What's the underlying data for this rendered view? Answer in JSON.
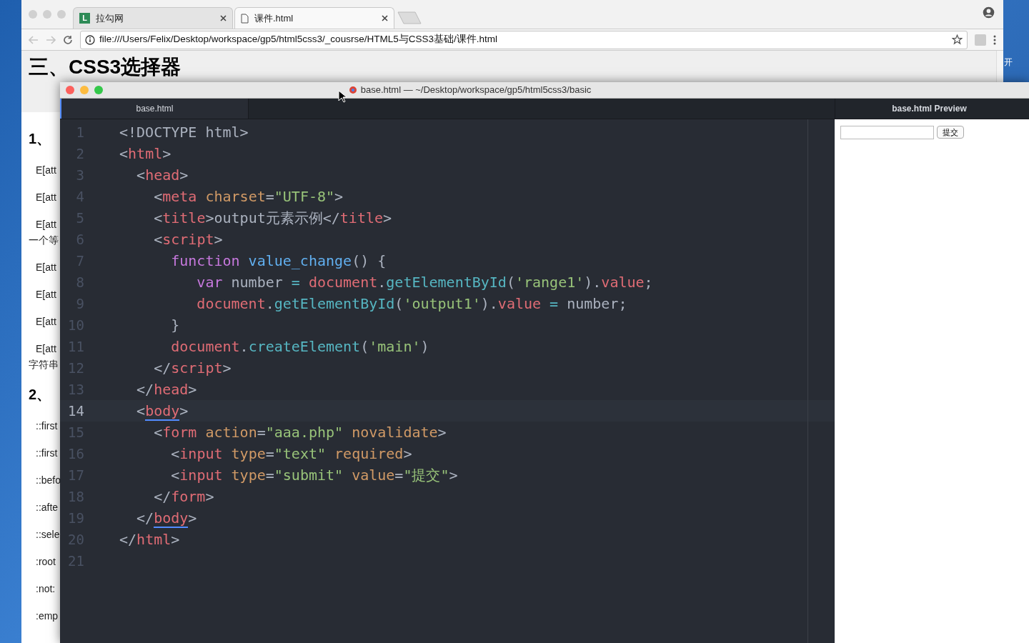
{
  "desktop": {
    "side_text": "开"
  },
  "browser": {
    "tabs": [
      {
        "title": "拉勾网",
        "selected": false,
        "kind": "brand",
        "icon_text": "L"
      },
      {
        "title": "课件.html",
        "selected": true,
        "kind": "page"
      }
    ],
    "url": "file:///Users/Felix/Desktop/workspace/gp5/html5css3/_cousrse/HTML5与CSS3基础/课件.html",
    "page": {
      "heading": "三、CSS3选择器",
      "entries": [
        {
          "kind": "section",
          "text": "1、"
        },
        {
          "kind": "item",
          "text": "E[att"
        },
        {
          "kind": "item",
          "text": "E[att"
        },
        {
          "kind": "item",
          "text": "E[att",
          "more": "一个等"
        },
        {
          "kind": "item",
          "text": "E[att"
        },
        {
          "kind": "item",
          "text": "E[att"
        },
        {
          "kind": "item",
          "text": "E[att"
        },
        {
          "kind": "item",
          "text": "E[att",
          "more": "字符串"
        },
        {
          "kind": "section",
          "text": "2、"
        },
        {
          "kind": "item",
          "text": "::first"
        },
        {
          "kind": "item",
          "text": "::first"
        },
        {
          "kind": "item",
          "text": "::befo"
        },
        {
          "kind": "item",
          "text": "::afte"
        },
        {
          "kind": "item",
          "text": "::sele"
        },
        {
          "kind": "item",
          "text": ":root"
        },
        {
          "kind": "item",
          "text": ":not:"
        },
        {
          "kind": "item",
          "text": ":emp"
        }
      ]
    }
  },
  "editor": {
    "title": "base.html — ~/Desktop/workspace/gp5/html5css3/basic",
    "tabs": [
      {
        "label": "base.html",
        "selected": true
      }
    ],
    "lines": [
      {
        "n": "1",
        "current": false,
        "tokens": [
          {
            "t": "<!DOCTYPE html>",
            "kind": "p"
          }
        ]
      },
      {
        "n": "2",
        "current": false,
        "tokens": [
          {
            "t": "<",
            "kind": "p"
          },
          {
            "t": "html",
            "kind": "tag"
          },
          {
            "t": ">",
            "kind": "p"
          }
        ]
      },
      {
        "n": "3",
        "current": false,
        "tokens": [
          {
            "t": "  <",
            "kind": "p"
          },
          {
            "t": "head",
            "kind": "tag"
          },
          {
            "t": ">",
            "kind": "p"
          }
        ]
      },
      {
        "n": "4",
        "current": false,
        "tokens": [
          {
            "t": "    <",
            "kind": "p"
          },
          {
            "t": "meta",
            "kind": "tag"
          },
          {
            "t": " charset",
            "kind": "attr"
          },
          {
            "t": "=",
            "kind": "p"
          },
          {
            "t": "\"UTF-8\"",
            "kind": "str"
          },
          {
            "t": ">",
            "kind": "p"
          }
        ]
      },
      {
        "n": "5",
        "current": false,
        "tokens": [
          {
            "t": "    <",
            "kind": "p"
          },
          {
            "t": "title",
            "kind": "tag"
          },
          {
            "t": ">output元素示例</",
            "kind": "p"
          },
          {
            "t": "title",
            "kind": "tag"
          },
          {
            "t": ">",
            "kind": "p"
          }
        ]
      },
      {
        "n": "6",
        "current": false,
        "tokens": [
          {
            "t": "    <",
            "kind": "p"
          },
          {
            "t": "script",
            "kind": "tag"
          },
          {
            "t": ">",
            "kind": "p"
          }
        ]
      },
      {
        "n": "7",
        "current": false,
        "tokens": [
          {
            "t": "      function",
            "kind": "kw"
          },
          {
            "t": " value_change",
            "kind": "fn"
          },
          {
            "t": "() {",
            "kind": "p"
          }
        ]
      },
      {
        "n": "8",
        "current": false,
        "tokens": [
          {
            "t": "         var",
            "kind": "kw"
          },
          {
            "t": " number ",
            "kind": "p"
          },
          {
            "t": "=",
            "kind": "op"
          },
          {
            "t": " document",
            "kind": "tag"
          },
          {
            "t": ".",
            "kind": "p"
          },
          {
            "t": "getElementById",
            "kind": "method"
          },
          {
            "t": "(",
            "kind": "p"
          },
          {
            "t": "'range1'",
            "kind": "str"
          },
          {
            "t": ").",
            "kind": "p"
          },
          {
            "t": "value",
            "kind": "tag"
          },
          {
            "t": ";",
            "kind": "p"
          }
        ]
      },
      {
        "n": "9",
        "current": false,
        "tokens": [
          {
            "t": "         document",
            "kind": "tag"
          },
          {
            "t": ".",
            "kind": "p"
          },
          {
            "t": "getElementById",
            "kind": "method"
          },
          {
            "t": "(",
            "kind": "p"
          },
          {
            "t": "'output1'",
            "kind": "str"
          },
          {
            "t": ").",
            "kind": "p"
          },
          {
            "t": "value",
            "kind": "tag"
          },
          {
            "t": " =",
            "kind": "op"
          },
          {
            "t": " number;",
            "kind": "p"
          }
        ]
      },
      {
        "n": "10",
        "current": false,
        "tokens": [
          {
            "t": "      }",
            "kind": "p"
          }
        ]
      },
      {
        "n": "11",
        "current": false,
        "tokens": [
          {
            "t": "      document",
            "kind": "tag"
          },
          {
            "t": ".",
            "kind": "p"
          },
          {
            "t": "createElement",
            "kind": "method"
          },
          {
            "t": "(",
            "kind": "p"
          },
          {
            "t": "'main'",
            "kind": "str"
          },
          {
            "t": ")",
            "kind": "p"
          }
        ]
      },
      {
        "n": "12",
        "current": false,
        "tokens": [
          {
            "t": "    </",
            "kind": "p"
          },
          {
            "t": "script",
            "kind": "tag"
          },
          {
            "t": ">",
            "kind": "p"
          }
        ]
      },
      {
        "n": "13",
        "current": false,
        "tokens": [
          {
            "t": "  </",
            "kind": "p"
          },
          {
            "t": "head",
            "kind": "tag"
          },
          {
            "t": ">",
            "kind": "p"
          }
        ]
      },
      {
        "n": "14",
        "current": true,
        "tokens": [
          {
            "t": "  <",
            "kind": "p"
          },
          {
            "t": "body",
            "kind": "match"
          },
          {
            "t": ">",
            "kind": "p"
          }
        ]
      },
      {
        "n": "15",
        "current": false,
        "tokens": [
          {
            "t": "    <",
            "kind": "p"
          },
          {
            "t": "form",
            "kind": "tag"
          },
          {
            "t": " action",
            "kind": "attr"
          },
          {
            "t": "=",
            "kind": "p"
          },
          {
            "t": "\"aaa.php\"",
            "kind": "str"
          },
          {
            "t": " novalidate",
            "kind": "attr"
          },
          {
            "t": ">",
            "kind": "p"
          }
        ]
      },
      {
        "n": "16",
        "current": false,
        "tokens": [
          {
            "t": "      <",
            "kind": "p"
          },
          {
            "t": "input",
            "kind": "tag"
          },
          {
            "t": " type",
            "kind": "attr"
          },
          {
            "t": "=",
            "kind": "p"
          },
          {
            "t": "\"text\"",
            "kind": "str"
          },
          {
            "t": " required",
            "kind": "attr"
          },
          {
            "t": ">",
            "kind": "p"
          }
        ]
      },
      {
        "n": "17",
        "current": false,
        "tokens": [
          {
            "t": "      <",
            "kind": "p"
          },
          {
            "t": "input",
            "kind": "tag"
          },
          {
            "t": " type",
            "kind": "attr"
          },
          {
            "t": "=",
            "kind": "p"
          },
          {
            "t": "\"submit\"",
            "kind": "str"
          },
          {
            "t": " value",
            "kind": "attr"
          },
          {
            "t": "=",
            "kind": "p"
          },
          {
            "t": "\"提交\"",
            "kind": "str"
          },
          {
            "t": ">",
            "kind": "p"
          }
        ]
      },
      {
        "n": "18",
        "current": false,
        "tokens": [
          {
            "t": "    </",
            "kind": "p"
          },
          {
            "t": "form",
            "kind": "tag"
          },
          {
            "t": ">",
            "kind": "p"
          }
        ]
      },
      {
        "n": "19",
        "current": false,
        "tokens": [
          {
            "t": "  </",
            "kind": "p"
          },
          {
            "t": "body",
            "kind": "match"
          },
          {
            "t": ">",
            "kind": "p"
          }
        ]
      },
      {
        "n": "20",
        "current": false,
        "tokens": [
          {
            "t": "</",
            "kind": "p"
          },
          {
            "t": "html",
            "kind": "tag"
          },
          {
            "t": ">",
            "kind": "p"
          }
        ]
      },
      {
        "n": "21",
        "current": false
      }
    ],
    "preview": {
      "tab": "base.html Preview",
      "button": "提交"
    }
  }
}
